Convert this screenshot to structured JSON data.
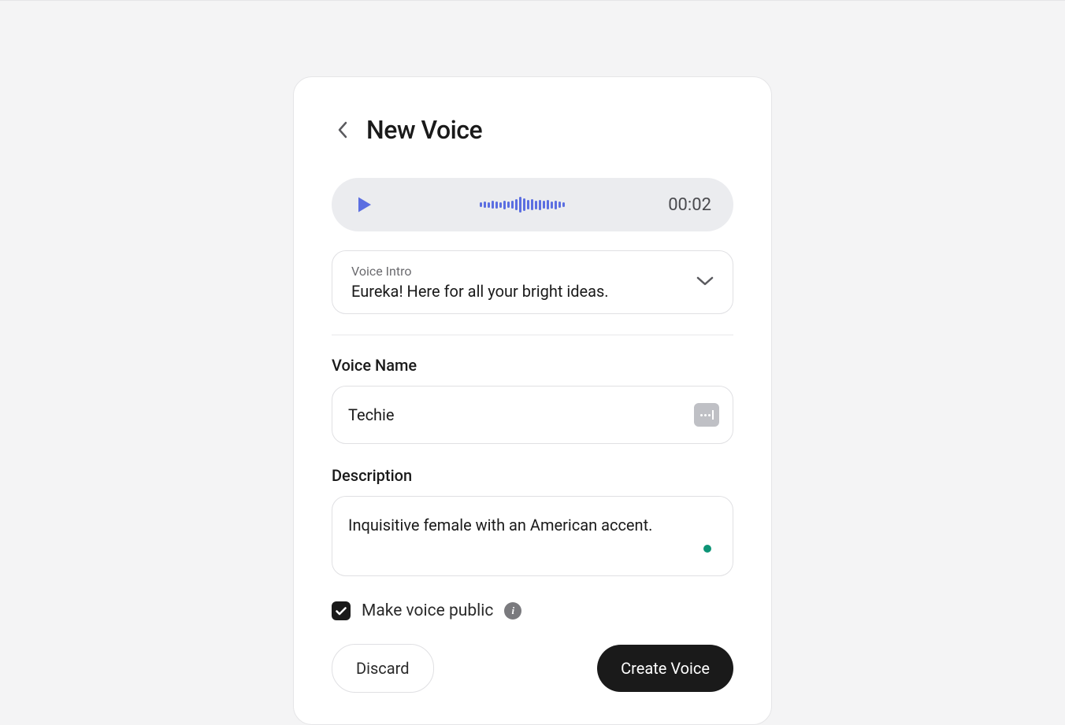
{
  "header": {
    "title": "New Voice"
  },
  "audioPlayer": {
    "timestamp": "00:02"
  },
  "voiceIntro": {
    "label": "Voice Intro",
    "value": "Eureka! Here for all your bright ideas."
  },
  "voiceName": {
    "label": "Voice Name",
    "value": "Techie"
  },
  "description": {
    "label": "Description",
    "value": "Inquisitive female with an American accent."
  },
  "makePublic": {
    "label": "Make voice public",
    "checked": true
  },
  "buttons": {
    "discard": "Discard",
    "create": "Create Voice"
  }
}
